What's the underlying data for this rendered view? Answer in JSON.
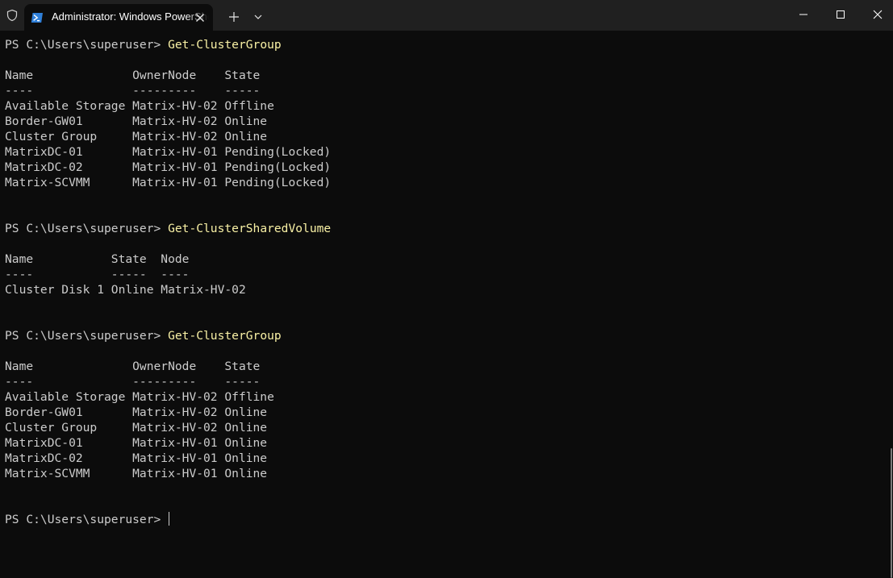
{
  "tab": {
    "title": "Administrator: Windows PowerShell"
  },
  "icons": {
    "shield": "shield-icon",
    "powershell": "powershell-icon",
    "close_tab": "close-icon",
    "new_tab": "plus-icon",
    "dropdown": "chevron-down-icon",
    "minimize": "minimize-icon",
    "maximize": "maximize-icon",
    "close_window": "close-icon"
  },
  "colors": {
    "background": "#0c0c0c",
    "titlebar": "#202020",
    "text": "#cccccc",
    "command": "#f9f1a5"
  },
  "terminal": {
    "lines": [
      {
        "prompt": "PS C:\\Users\\superuser> ",
        "command": "Get-ClusterGroup"
      },
      {
        "text": ""
      },
      {
        "text": "Name              OwnerNode    State"
      },
      {
        "text": "----              ---------    -----"
      },
      {
        "text": "Available Storage Matrix-HV-02 Offline"
      },
      {
        "text": "Border-GW01       Matrix-HV-02 Online"
      },
      {
        "text": "Cluster Group     Matrix-HV-02 Online"
      },
      {
        "text": "MatrixDC-01       Matrix-HV-01 Pending(Locked)"
      },
      {
        "text": "MatrixDC-02       Matrix-HV-01 Pending(Locked)"
      },
      {
        "text": "Matrix-SCVMM      Matrix-HV-01 Pending(Locked)"
      },
      {
        "text": ""
      },
      {
        "text": ""
      },
      {
        "prompt": "PS C:\\Users\\superuser> ",
        "command": "Get-ClusterSharedVolume"
      },
      {
        "text": ""
      },
      {
        "text": "Name           State  Node"
      },
      {
        "text": "----           -----  ----"
      },
      {
        "text": "Cluster Disk 1 Online Matrix-HV-02"
      },
      {
        "text": ""
      },
      {
        "text": ""
      },
      {
        "prompt": "PS C:\\Users\\superuser> ",
        "command": "Get-ClusterGroup"
      },
      {
        "text": ""
      },
      {
        "text": "Name              OwnerNode    State"
      },
      {
        "text": "----              ---------    -----"
      },
      {
        "text": "Available Storage Matrix-HV-02 Offline"
      },
      {
        "text": "Border-GW01       Matrix-HV-02 Online"
      },
      {
        "text": "Cluster Group     Matrix-HV-02 Online"
      },
      {
        "text": "MatrixDC-01       Matrix-HV-01 Online"
      },
      {
        "text": "MatrixDC-02       Matrix-HV-01 Online"
      },
      {
        "text": "Matrix-SCVMM      Matrix-HV-01 Online"
      },
      {
        "text": ""
      },
      {
        "text": ""
      },
      {
        "prompt": "PS C:\\Users\\superuser> ",
        "command": "",
        "cursor": true
      }
    ]
  }
}
